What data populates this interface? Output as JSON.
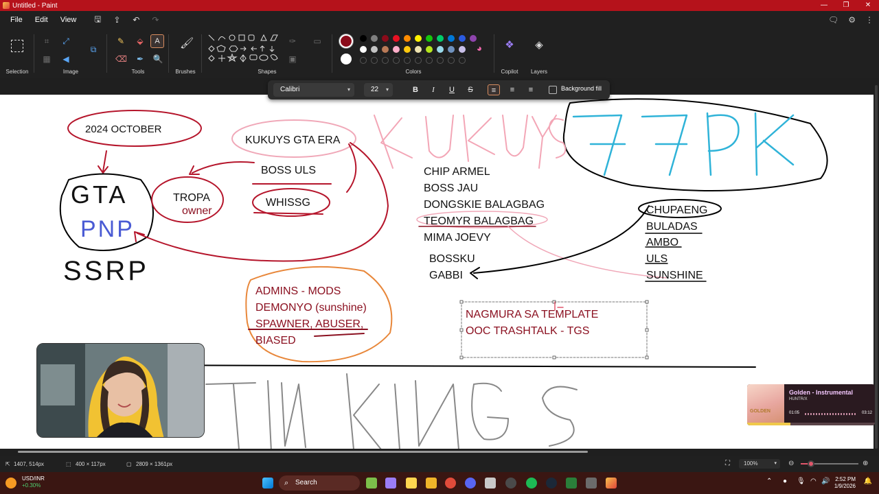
{
  "window": {
    "title": "Untitled - Paint",
    "controls": [
      "minimize-icon",
      "maximize-icon",
      "close-icon"
    ]
  },
  "menu": {
    "items": [
      "File",
      "Edit",
      "View"
    ],
    "quick_actions": [
      "save-icon",
      "share-icon",
      "undo-icon",
      "redo-icon"
    ]
  },
  "ribbon": {
    "groups": {
      "selection": "Selection",
      "image": "Image",
      "tools": "Tools",
      "brushes": "Brushes",
      "shapes": "Shapes",
      "colors": "Colors",
      "copilot": "Copilot",
      "layers": "Layers"
    },
    "colors": {
      "primary": "#8b0b1a",
      "secondary": "#ffffff",
      "palette_row1": [
        "#000000",
        "#7f7f7f",
        "#8b0b1a",
        "#e81123",
        "#ff8c00",
        "#fff100",
        "#16c60c",
        "#00cc6a",
        "#0078d7",
        "#2b5be0",
        "#8e44ad"
      ],
      "palette_row2": [
        "#ffffff",
        "#c3c3c3",
        "#b97a57",
        "#ffaec9",
        "#ffc90e",
        "#efe4b0",
        "#b5e61d",
        "#99d9ea",
        "#7092be",
        "#c8bfe7"
      ]
    }
  },
  "text_toolbar": {
    "font": "Calibri",
    "size": "22",
    "buttons": {
      "bold": "B",
      "italic": "I",
      "underline": "U",
      "strike": "S"
    },
    "background_fill": "Background fill"
  },
  "canvas": {
    "text": {
      "date": "2024 OCTOBER",
      "gta": "GTA",
      "pnp": "PNP",
      "ssrp": "SSRP",
      "tropa": "TROPA",
      "owner": "owner",
      "kukuys_era": "KUKUYS GTA ERA",
      "boss_uls": "BOSS ULS",
      "whissg": "WHISSG",
      "admins": [
        "ADMINS - MODS",
        "DEMONYO (sunshine)",
        "SPAWNER, ABUSER,",
        "BIASED"
      ],
      "kukuys_big": "KUKUYS",
      "pk_big": "77PK",
      "members": [
        "CHIP ARMEL",
        "BOSS JAU",
        "DONGSKIE BALAGBAG",
        "TEOMYR BALAGBAG",
        "MIMA JOEVY"
      ],
      "bossku": "BOSSKU",
      "gabbi": "GABBI",
      "pk_members": [
        "CHUPAENG",
        "BULADAS",
        "AMBO",
        "ULS",
        "SUNSHINE"
      ],
      "textbox_lines": [
        "NAGMURA SA TEMPLATE",
        "OOC TRASHTALK - TGS"
      ],
      "bottom_big": "TIN KINGS"
    }
  },
  "statusbar": {
    "cursor": "1407, 514px",
    "selection": "400 × 117px",
    "canvas_size": "2809 × 1361px",
    "zoom": "100%",
    "zoom_level_fraction": 0.18
  },
  "overlays": {
    "music": {
      "title": "Golden - Instrumental",
      "artist": "HUNTR/X",
      "current": "01:05",
      "total": "03:12",
      "art_label": "GOLDEN",
      "progress": 0.34
    }
  },
  "taskbar": {
    "stock_name": "USD/INR",
    "stock_change": "+0.30%",
    "search": "Search",
    "time": "2:52 PM",
    "date": "1/9/2026"
  }
}
